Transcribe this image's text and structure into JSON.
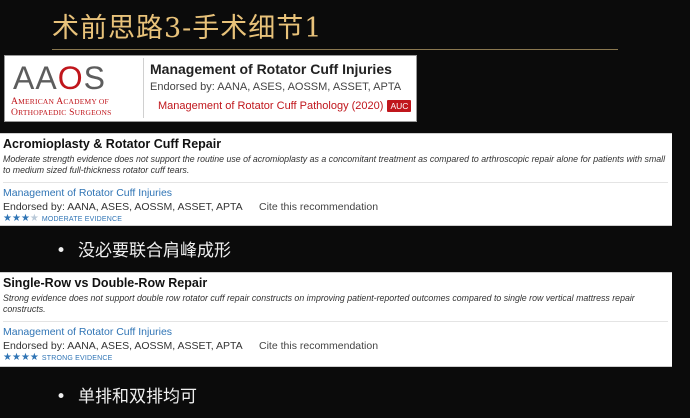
{
  "slide": {
    "title": "术前思路3-手术细节1"
  },
  "aaos_header": {
    "logo_text": "AAOS",
    "logo_sub1": "American Academy of",
    "logo_sub2": "Orthopaedic Surgeons",
    "heading": "Management of Rotator Cuff Injuries",
    "endorsed": "Endorsed by: AANA, ASES, AOSSM, ASSET, APTA",
    "link": "Management of Rotator Cuff Pathology (2020)",
    "badge": "AUC"
  },
  "recommendations": [
    {
      "title": "Acromioplasty & Rotator Cuff Repair",
      "description": "Moderate strength evidence does not support the routine use of acromioplasty as a concomitant treatment as compared to arthroscopic repair alone for patients with small to medium sized full-thickness rotator cuff tears.",
      "link": "Management of Rotator Cuff Injuries",
      "endorsed": "Endorsed by: AANA, ASES, AOSSM, ASSET, APTA",
      "cite": "Cite this recommendation",
      "stars_filled": 3,
      "stars_total": 4,
      "strength_label": "MODERATE EVIDENCE"
    },
    {
      "title": "Single-Row vs Double-Row Repair",
      "description": "Strong evidence does not support double row rotator cuff repair constructs on improving patient-reported outcomes compared to single row vertical mattress repair constructs.",
      "link": "Management of Rotator Cuff Injuries",
      "endorsed": "Endorsed by: AANA, ASES, AOSSM, ASSET, APTA",
      "cite": "Cite this recommendation",
      "stars_filled": 4,
      "stars_total": 4,
      "strength_label": "STRONG EVIDENCE"
    }
  ],
  "bullets": [
    {
      "marker": "•",
      "text": "没必要联合肩峰成形"
    },
    {
      "marker": "•",
      "text": "单排和双排均可"
    }
  ],
  "colors": {
    "title_gold": "#e8c27a",
    "aaos_red": "#c0161c",
    "link_blue": "#2f74b5",
    "background": "#0b0b0b"
  }
}
